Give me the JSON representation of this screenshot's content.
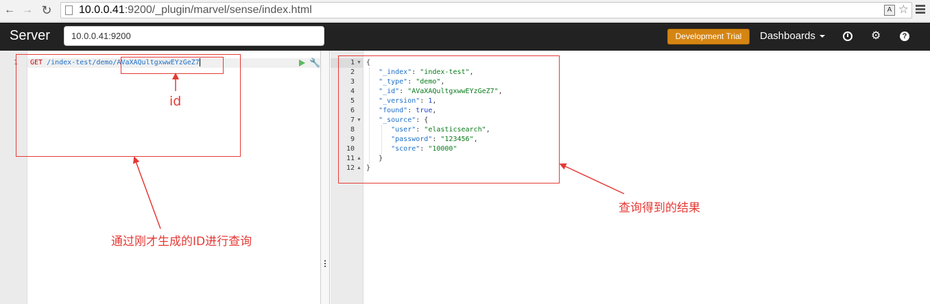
{
  "browser": {
    "back_icon": "back-arrow-icon",
    "forward_icon": "forward-arrow-icon",
    "reload_icon": "reload-icon",
    "url_host": "10.0.0.41",
    "url_path": ":9200/_plugin/marvel/sense/index.html"
  },
  "header": {
    "title": "Server",
    "server_value": "10.0.0.41:9200",
    "dev_trial": "Development Trial",
    "dashboards": "Dashboards"
  },
  "request": {
    "line_number": "1",
    "method": "GET",
    "path": " /index-test/demo/",
    "doc_id": "AVaXAQultgxwwEYzGeZ7"
  },
  "response": {
    "line_numbers": [
      "1",
      "2",
      "3",
      "4",
      "5",
      "6",
      "7",
      "8",
      "9",
      "10",
      "11",
      "12"
    ],
    "lines": {
      "l1": "{",
      "l2_key": "\"_index\"",
      "l2_val": "\"index-test\"",
      "l3_key": "\"_type\"",
      "l3_val": "\"demo\"",
      "l4_key": "\"_id\"",
      "l4_val": "\"AVaXAQultgxwwEYzGeZ7\"",
      "l5_key": "\"_version\"",
      "l5_val": "1",
      "l6_key": "\"found\"",
      "l6_val": "true",
      "l7_key": "\"_source\"",
      "l7_val": "{",
      "l8_key": "\"user\"",
      "l8_val": "\"elasticsearch\"",
      "l9_key": "\"password\"",
      "l9_val": "\"123456\"",
      "l10_key": "\"score\"",
      "l10_val": "\"10000\"",
      "l11": "}",
      "l12": "}"
    }
  },
  "annotations": {
    "id_label": "id",
    "query_label": "通过刚才生成的ID进行查询",
    "result_label": "查询得到的结果"
  },
  "colors": {
    "header_bg": "#222222",
    "dev_trial_bg": "#d58512",
    "annotation": "#e53935"
  }
}
